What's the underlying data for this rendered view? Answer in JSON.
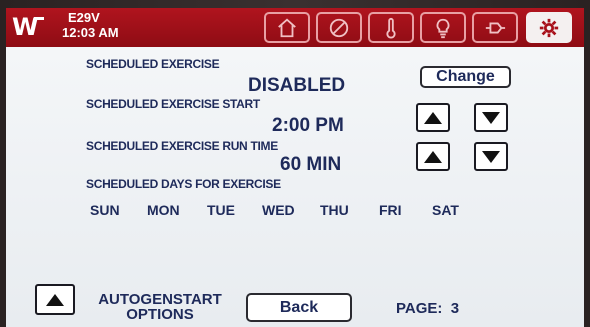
{
  "header": {
    "model": "E29V",
    "time": "12:03 AM",
    "nav_icons": [
      "home-icon",
      "no-symbol-icon",
      "thermometer-icon",
      "lightbulb-icon",
      "plug-icon",
      "gear-icon"
    ],
    "accent_color": "#a8101a"
  },
  "exercise": {
    "scheduled_label": "SCHEDULED EXERCISE",
    "scheduled_value": "DISABLED",
    "change_label": "Change",
    "start_label": "SCHEDULED EXERCISE START",
    "start_value": "2:00 PM",
    "runtime_label": "SCHEDULED EXERCISE RUN TIME",
    "runtime_value": "60 MIN",
    "days_label": "SCHEDULED DAYS FOR EXERCISE",
    "days": [
      "SUN",
      "MON",
      "TUE",
      "WED",
      "THU",
      "FRI",
      "SAT"
    ]
  },
  "footer": {
    "autogen_line1": "AUTOGENSTART",
    "autogen_line2": "OPTIONS",
    "back_label": "Back",
    "page_label": "PAGE:",
    "page_number": "3"
  }
}
